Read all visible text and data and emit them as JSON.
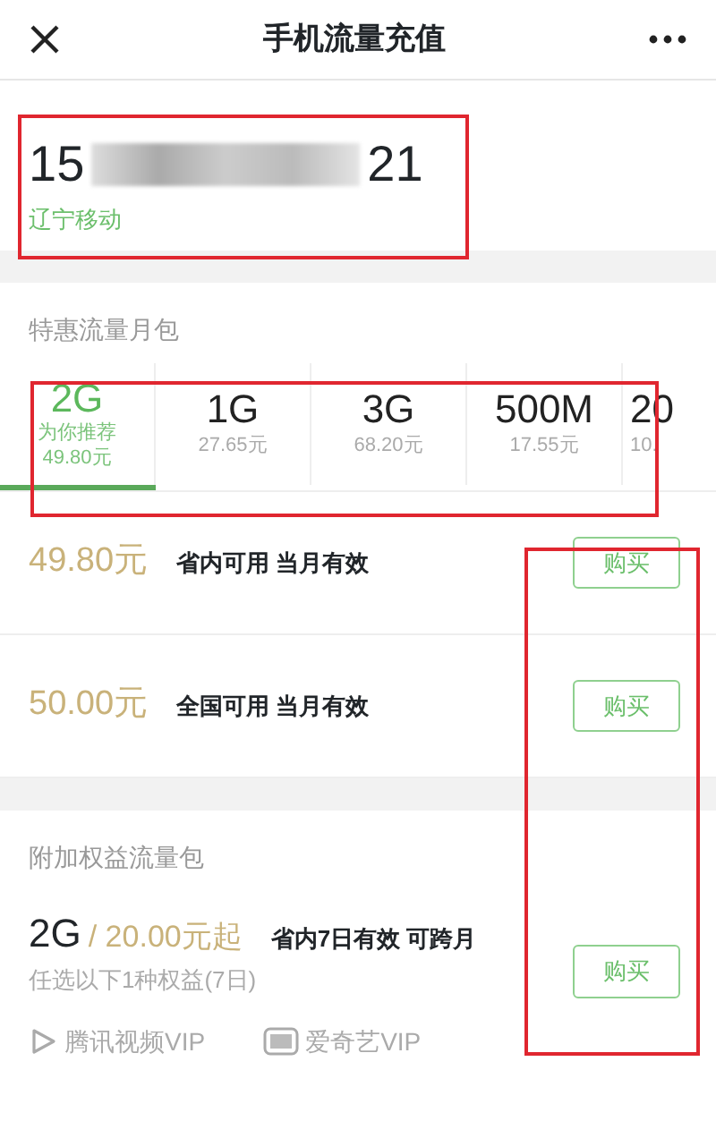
{
  "header": {
    "title": "手机流量充值"
  },
  "account": {
    "number_start": "15",
    "number_end": "21",
    "carrier": "辽宁移动"
  },
  "monthly": {
    "heading": "特惠流量月包",
    "packages": [
      {
        "size": "2G",
        "note": "为你推荐",
        "price": "49.80元",
        "selected": true
      },
      {
        "size": "1G",
        "price": "27.65元",
        "selected": false
      },
      {
        "size": "3G",
        "price": "68.20元",
        "selected": false
      },
      {
        "size": "500M",
        "price": "17.55元",
        "selected": false
      },
      {
        "size": "20",
        "price": "10.",
        "selected": false
      }
    ],
    "offers": [
      {
        "price": "49.80元",
        "desc": "省内可用 当月有效",
        "button": "购买"
      },
      {
        "price": "50.00元",
        "desc": "全国可用 当月有效",
        "button": "购买"
      }
    ]
  },
  "extra": {
    "heading": "附加权益流量包",
    "size": "2G",
    "price": "/ 20.00元起",
    "desc": "省内7日有效 可跨月",
    "sub": "任选以下1种权益(7日)",
    "button": "购买",
    "perks": [
      {
        "kind": "video",
        "label": "腾讯视频VIP"
      },
      {
        "kind": "tv",
        "label": "爱奇艺VIP"
      }
    ]
  }
}
